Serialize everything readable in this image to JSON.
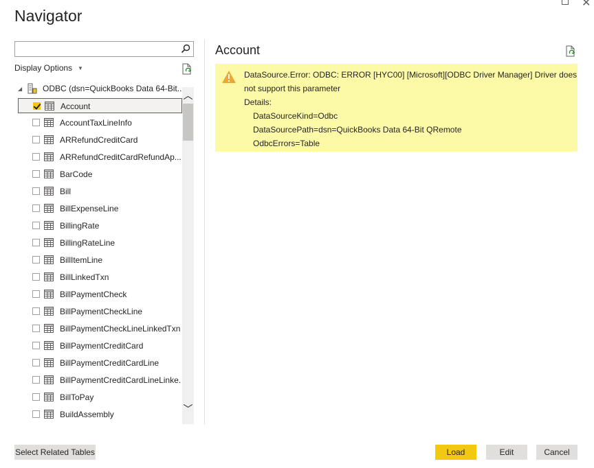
{
  "window": {
    "title": "Navigator"
  },
  "search": {
    "placeholder": "",
    "value": ""
  },
  "display_options": {
    "label": "Display Options"
  },
  "tree": {
    "root_label": "ODBC (dsn=QuickBooks Data 64-Bit...",
    "items": [
      {
        "label": "Account",
        "checked": true,
        "selected": true
      },
      {
        "label": "AccountTaxLineInfo",
        "checked": false,
        "selected": false
      },
      {
        "label": "ARRefundCreditCard",
        "checked": false,
        "selected": false
      },
      {
        "label": "ARRefundCreditCardRefundAp...",
        "checked": false,
        "selected": false
      },
      {
        "label": "BarCode",
        "checked": false,
        "selected": false
      },
      {
        "label": "Bill",
        "checked": false,
        "selected": false
      },
      {
        "label": "BillExpenseLine",
        "checked": false,
        "selected": false
      },
      {
        "label": "BillingRate",
        "checked": false,
        "selected": false
      },
      {
        "label": "BillingRateLine",
        "checked": false,
        "selected": false
      },
      {
        "label": "BillItemLine",
        "checked": false,
        "selected": false
      },
      {
        "label": "BillLinkedTxn",
        "checked": false,
        "selected": false
      },
      {
        "label": "BillPaymentCheck",
        "checked": false,
        "selected": false
      },
      {
        "label": "BillPaymentCheckLine",
        "checked": false,
        "selected": false
      },
      {
        "label": "BillPaymentCheckLineLinkedTxn",
        "checked": false,
        "selected": false
      },
      {
        "label": "BillPaymentCreditCard",
        "checked": false,
        "selected": false
      },
      {
        "label": "BillPaymentCreditCardLine",
        "checked": false,
        "selected": false
      },
      {
        "label": "BillPaymentCreditCardLineLinke...",
        "checked": false,
        "selected": false
      },
      {
        "label": "BillToPay",
        "checked": false,
        "selected": false
      },
      {
        "label": "BuildAssembly",
        "checked": false,
        "selected": false
      }
    ]
  },
  "preview": {
    "title": "Account",
    "error_lines": [
      "DataSource.Error: ODBC: ERROR [HYC00] [Microsoft][ODBC Driver Manager] Driver does",
      "not support this parameter",
      "Details:",
      "DataSourceKind=Odbc",
      "DataSourcePath=dsn=QuickBooks Data 64-Bit QRemote",
      "OdbcErrors=Table"
    ]
  },
  "buttons": {
    "select_related": "Select Related Tables",
    "load": "Load",
    "edit": "Edit",
    "cancel": "Cancel"
  },
  "colors": {
    "accent": "#f2c811",
    "error_background": "#fcf9a7",
    "warning_icon": "#e8a93b"
  }
}
